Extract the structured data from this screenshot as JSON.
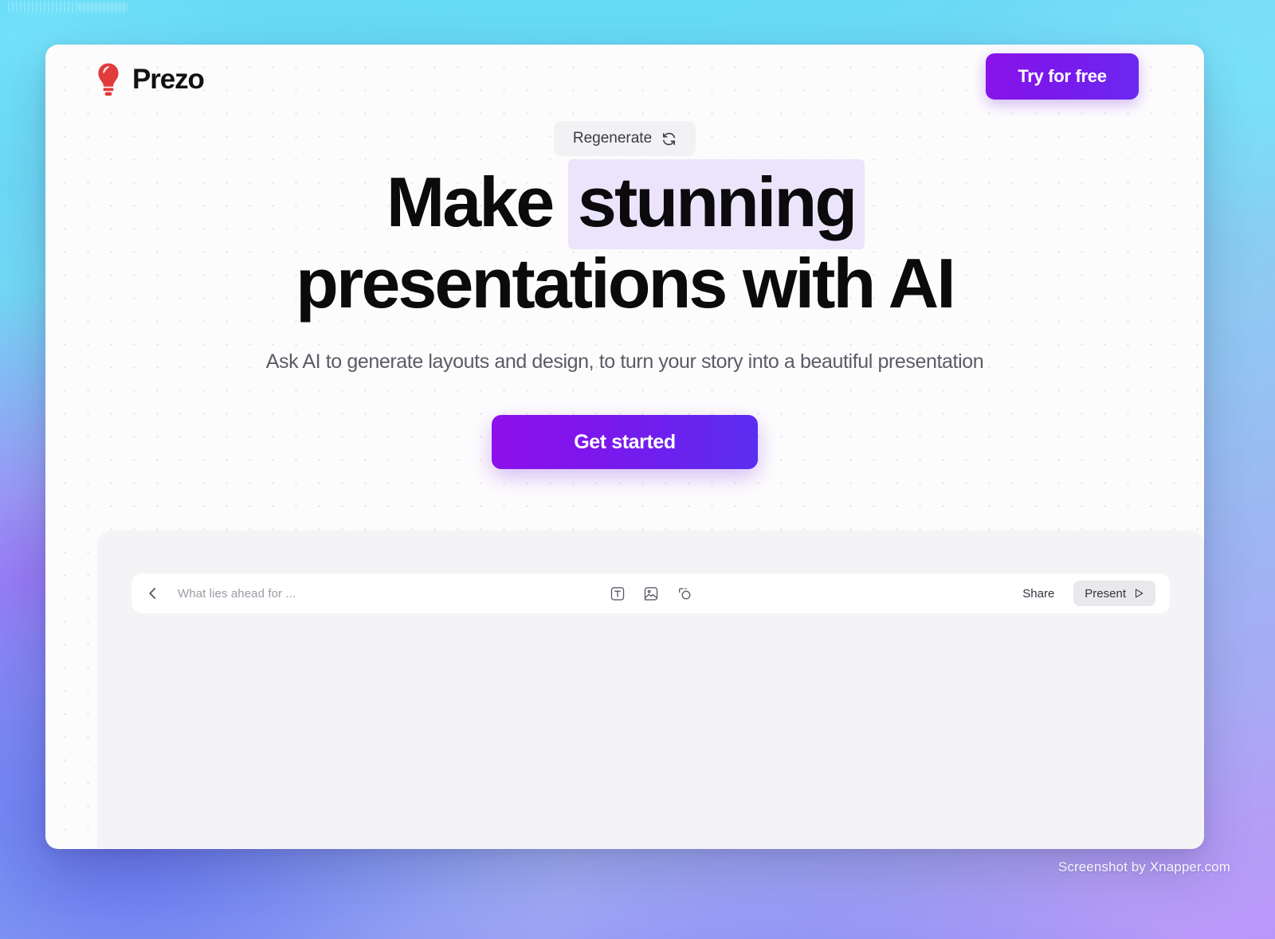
{
  "brand": {
    "name": "Prezo",
    "logo_icon": "lightbulb-icon",
    "logo_color": "#e23b3b"
  },
  "header": {
    "try_free_label": "Try for free",
    "try_free_gradient_from": "#8a14e8",
    "try_free_gradient_to": "#6b28f0"
  },
  "hero": {
    "regenerate_label": "Regenerate",
    "regenerate_icon": "refresh-icon",
    "title_line1_plain": "Make ",
    "title_line1_highlight": "stunning",
    "title_line2": "presentations with AI",
    "highlight_color": "#ece4fa",
    "subtitle": "Ask AI to generate layouts and design, to turn your story into a beautiful presentation",
    "cta_label": "Get started",
    "cta_gradient_from": "#8d10ea",
    "cta_gradient_to": "#5a2ef0"
  },
  "editor": {
    "back_icon": "chevron-left-icon",
    "deck_title": "What lies ahead for ...",
    "tools": [
      {
        "name": "text-tool-icon",
        "label": "T"
      },
      {
        "name": "image-tool-icon",
        "label": "Image"
      },
      {
        "name": "shape-tool-icon",
        "label": "Shape"
      }
    ],
    "share_label": "Share",
    "present_label": "Present",
    "present_icon": "play-icon"
  },
  "watermark": {
    "text": "Screenshot by Xnapper.com"
  }
}
